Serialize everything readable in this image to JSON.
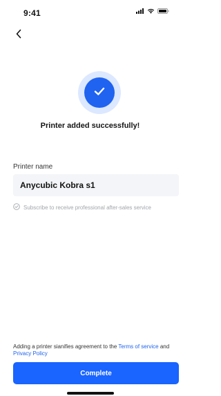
{
  "status_bar": {
    "time": "9:41",
    "icons": [
      "cellular-signal-icon",
      "wifi-icon",
      "battery-icon"
    ]
  },
  "nav": {
    "back_icon": "chevron-left-icon"
  },
  "success": {
    "icon": "checkmark-icon",
    "title": "Printer added successfully!"
  },
  "form": {
    "printer_name_label": "Printer name",
    "printer_name_value": "Anycubic Kobra s1",
    "subscribe_label": "Subscribe to receive professional after-sales service",
    "subscribe_checked": false
  },
  "agreement": {
    "prefix": "Adding a printer sianifies agreement to the ",
    "terms_link": "Terms of service",
    "conjunction": " and ",
    "privacy_link": "Privacy Policy"
  },
  "actions": {
    "complete_label": "Complete"
  },
  "colors": {
    "accent": "#1a64ff",
    "badge_ring": "#dce8ff",
    "input_bg": "#f4f5f8",
    "muted_text": "#a2a5ab"
  }
}
